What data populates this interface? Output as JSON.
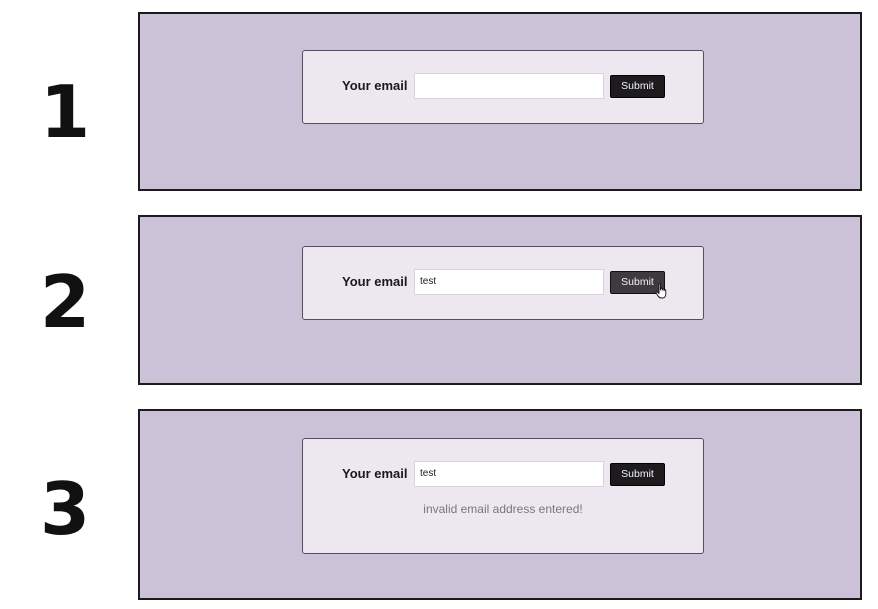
{
  "steps": [
    {
      "number": "1",
      "label": "Your email",
      "input_value": "",
      "submit_label": "Submit",
      "submit_state": "normal",
      "cursor": false,
      "error": ""
    },
    {
      "number": "2",
      "label": "Your email",
      "input_value": "test",
      "submit_label": "Submit",
      "submit_state": "hover",
      "cursor": true,
      "error": ""
    },
    {
      "number": "3",
      "label": "Your email",
      "input_value": "test",
      "submit_label": "Submit",
      "submit_state": "normal",
      "cursor": false,
      "error": "invalid email address entered!"
    }
  ],
  "colors": {
    "panel_bg": "#cbc2d8",
    "form_bg": "#ede7f0",
    "button_bg": "#1d1b1e",
    "button_hover_bg": "#3d3b40",
    "error_text": "#7a7580"
  },
  "icons": {
    "cursor": "hand-pointer-icon"
  }
}
